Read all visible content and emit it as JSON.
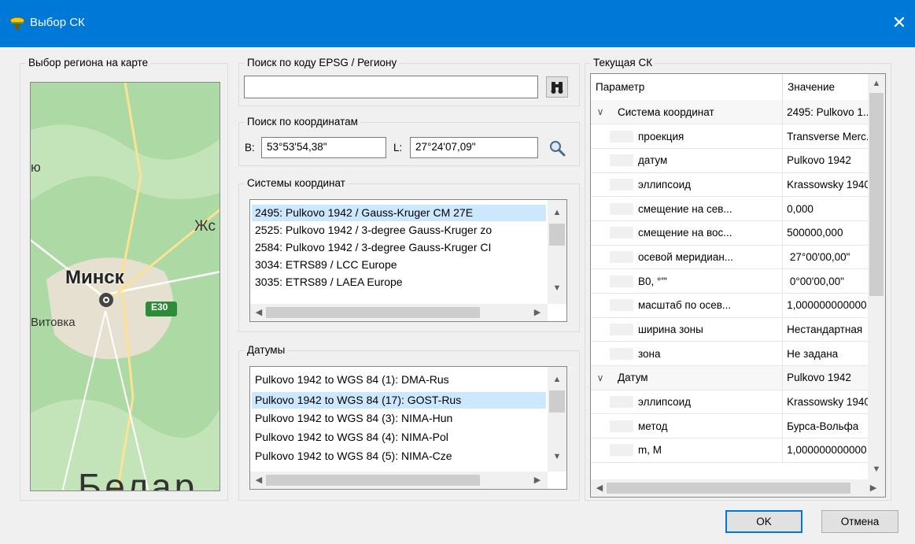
{
  "window": {
    "title": "Выбор СК",
    "close_glyph": "✕"
  },
  "map_group": {
    "label": "Выбор региона на карте",
    "labels": {
      "city": "Минск",
      "left_fragment": "ю",
      "right_fragment": "Жс",
      "district": "Витовка",
      "road": "E30",
      "bottom": "Белар"
    }
  },
  "search_group": {
    "label": "Поиск по коду EPSG / Региону",
    "input_value": ""
  },
  "coords_group": {
    "label": "Поиск по координатам",
    "b_label": "B:",
    "b_value": "53°53'54,38\"",
    "l_label": "L:",
    "l_value": "27°24'07,09\""
  },
  "systems_group": {
    "label": "Системы координат",
    "items": [
      "2495: Pulkovo 1942 / Gauss-Kruger CM 27E",
      "2525: Pulkovo 1942 / 3-degree Gauss-Kruger zo",
      "2584: Pulkovo 1942 / 3-degree Gauss-Kruger CI",
      "3034: ETRS89 / LCC Europe",
      "3035: ETRS89 / LAEA Europe"
    ],
    "selected_index": 0
  },
  "datums_group": {
    "label": "Датумы",
    "items": [
      "Pulkovo 1942 to WGS 84 (1): DMA-Rus",
      "Pulkovo 1942 to WGS 84 (17): GOST-Rus",
      "Pulkovo 1942 to WGS 84 (3): NIMA-Hun",
      "Pulkovo 1942 to WGS 84 (4): NIMA-Pol",
      "Pulkovo 1942 to WGS 84 (5): NIMA-Cze"
    ],
    "selected_index": 1
  },
  "current_group": {
    "label": "Текущая СК",
    "columns": [
      "Параметр",
      "Значение"
    ],
    "rows": [
      {
        "param": "Система координат",
        "value": "2495: Pulkovo 1...",
        "level": 0,
        "expander": "∨"
      },
      {
        "param": "проекция",
        "value": "Transverse Merc...",
        "level": 1,
        "expander": ""
      },
      {
        "param": "датум",
        "value": "Pulkovo 1942",
        "level": 1,
        "expander": ""
      },
      {
        "param": "эллипсоид",
        "value": "Krassowsky 1940",
        "level": 1,
        "expander": ""
      },
      {
        "param": "смещение на сев...",
        "value": "0,000",
        "level": 1,
        "expander": ""
      },
      {
        "param": "смещение на вос...",
        "value": "500000,000",
        "level": 1,
        "expander": ""
      },
      {
        "param": "осевой меридиан...",
        "value": " 27°00'00,00\"",
        "level": 1,
        "expander": ""
      },
      {
        "param": "B0, °'\"",
        "value": " 0°00'00,00\"",
        "level": 1,
        "expander": ""
      },
      {
        "param": "масштаб по осев...",
        "value": "1,000000000000",
        "level": 1,
        "expander": ""
      },
      {
        "param": "ширина зоны",
        "value": "Нестандартная",
        "level": 1,
        "expander": ""
      },
      {
        "param": "зона",
        "value": "Не задана",
        "level": 1,
        "expander": ""
      },
      {
        "param": "Датум",
        "value": "Pulkovo 1942",
        "level": 0,
        "expander": "∨"
      },
      {
        "param": "эллипсоид",
        "value": "Krassowsky 1940",
        "level": 1,
        "expander": ""
      },
      {
        "param": "метод",
        "value": "Бурса-Вольфа",
        "level": 1,
        "expander": ""
      },
      {
        "param": "m, M",
        "value": "1,000000000000",
        "level": 1,
        "expander": ""
      }
    ]
  },
  "buttons": {
    "ok": "OK",
    "cancel": "Отмена"
  },
  "icons": {
    "app": "app-globe-icon",
    "binoculars": "binoculars-icon",
    "magnifier": "magnifier-icon"
  },
  "colors": {
    "accent": "#0078d7",
    "selection": "#cce8ff"
  }
}
